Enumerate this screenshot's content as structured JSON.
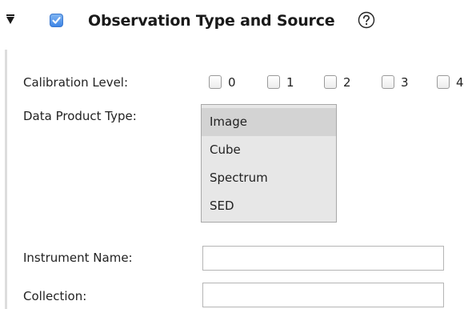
{
  "section": {
    "title": "Observation Type and Source",
    "enabled": true,
    "expanded": true,
    "accent_color": "#4a8fe9"
  },
  "icons": {
    "collapse": "triangle-down-icon",
    "help": "question-circle-icon",
    "check": "checkmark-icon"
  },
  "calibration": {
    "label": "Calibration Level:",
    "options": [
      {
        "label": "0",
        "checked": false
      },
      {
        "label": "1",
        "checked": false
      },
      {
        "label": "2",
        "checked": false
      },
      {
        "label": "3",
        "checked": false
      },
      {
        "label": "4",
        "checked": false
      }
    ]
  },
  "data_product": {
    "label": "Data Product Type:",
    "options": [
      "Image",
      "Cube",
      "Spectrum",
      "SED"
    ],
    "highlighted": "Image"
  },
  "instrument": {
    "label": "Instrument Name:",
    "value": "",
    "placeholder": ""
  },
  "collection": {
    "label": "Collection:",
    "value": "",
    "placeholder": ""
  }
}
